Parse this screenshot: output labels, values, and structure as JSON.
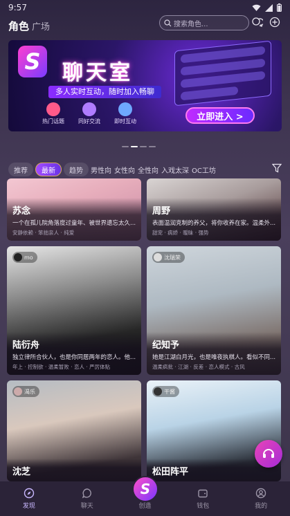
{
  "status_bar": {
    "time": "9:57"
  },
  "top_nav": {
    "tabs": [
      "角色",
      "广场"
    ],
    "search_placeholder": "搜索角色..."
  },
  "banner": {
    "title": "聊天室",
    "subtitle": "多人实时互动，随时加入畅聊",
    "features": [
      "热门话题",
      "同好交流",
      "即时互动"
    ],
    "cta": "立即进入 >"
  },
  "filters": {
    "chips": [
      "推荐",
      "最新",
      "趋势"
    ],
    "active_chip": "最新",
    "texts": [
      "男性向",
      "女性向",
      "全性向",
      "入戏太深",
      "OC工坊"
    ]
  },
  "cards": [
    {
      "name": "苏念",
      "creator": "",
      "desc": "一个在孤儿院角落度过童年、被世界遗忘太久...",
      "tags": "安静依赖 · 笨拙亲人 · 纯爱"
    },
    {
      "name": "周野",
      "creator": "",
      "desc": "表面温润克制的养父，将你收养在家。温柔外...",
      "tags": "甜宠 · 病娇 · 暧昧 · 强势"
    },
    {
      "name": "陆衍舟",
      "creator": "mo",
      "desc": "独立律所合伙人，也是你同居两年的恋人。他...",
      "tags": "年上 · 控制欲 · 温柔暂败 · 恋人 · 严厉体贴"
    },
    {
      "name": "纪知予",
      "creator": "沈瑞荣",
      "desc": "她是江湖白月光，也是唯夜执棋人。看似不同...",
      "tags": "温柔疯批 · 江湖 · 反差 · 恋人模式 · 古风"
    },
    {
      "name": "沈芝",
      "creator": "渴乐",
      "desc": "",
      "tags": ""
    },
    {
      "name": "松田阵平",
      "creator": "干酱",
      "desc": "",
      "tags": ""
    }
  ],
  "bottom_nav": {
    "items": [
      "发现",
      "聊天",
      "创造",
      "钱包",
      "我的"
    ],
    "active": "发现"
  }
}
